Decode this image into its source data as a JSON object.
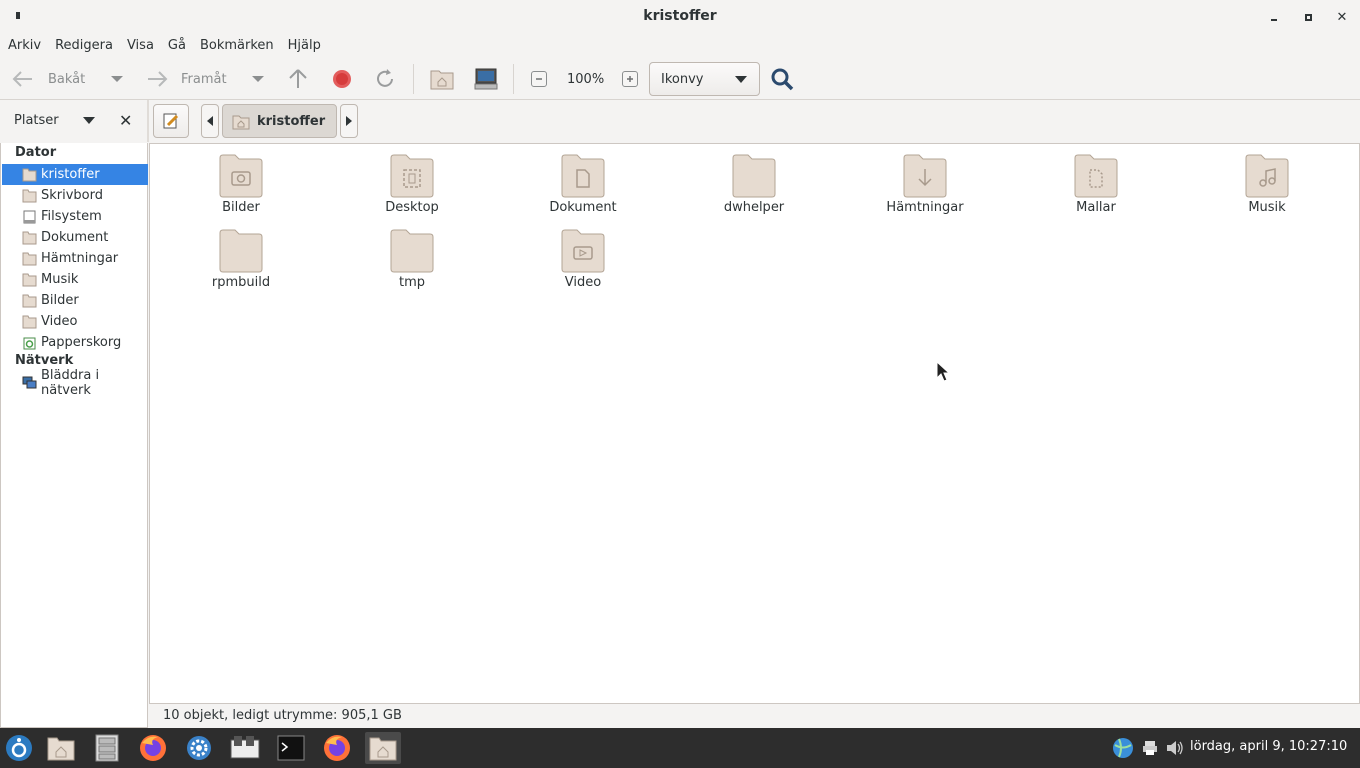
{
  "window": {
    "title": "kristoffer"
  },
  "menubar": [
    "Arkiv",
    "Redigera",
    "Visa",
    "Gå",
    "Bokmärken",
    "Hjälp"
  ],
  "toolbar": {
    "back_label": "Bakåt",
    "forward_label": "Framåt",
    "zoom_level": "100%",
    "view_mode": "Ikonvy"
  },
  "locationbar": {
    "places_label": "Platser",
    "crumb": "kristoffer"
  },
  "sidebar": {
    "sections": [
      {
        "title": "Dator",
        "items": [
          "kristoffer",
          "Skrivbord",
          "Filsystem",
          "Dokument",
          "Hämtningar",
          "Musik",
          "Bilder",
          "Video",
          "Papperskorg"
        ]
      },
      {
        "title": "Nätverk",
        "items": [
          "Bläddra i nätverk"
        ]
      }
    ],
    "selected": "kristoffer"
  },
  "files": [
    {
      "name": "Bilder",
      "icon": "pictures-folder-icon"
    },
    {
      "name": "Desktop",
      "icon": "desktop-folder-icon"
    },
    {
      "name": "Dokument",
      "icon": "documents-folder-icon"
    },
    {
      "name": "dwhelper",
      "icon": "folder-icon"
    },
    {
      "name": "Hämtningar",
      "icon": "downloads-folder-icon"
    },
    {
      "name": "Mallar",
      "icon": "templates-folder-icon"
    },
    {
      "name": "Musik",
      "icon": "music-folder-icon"
    },
    {
      "name": "rpmbuild",
      "icon": "folder-icon"
    },
    {
      "name": "tmp",
      "icon": "folder-icon"
    },
    {
      "name": "Video",
      "icon": "video-folder-icon"
    }
  ],
  "statusbar": {
    "text": "10 objekt, ledigt utrymme: 905,1 GB"
  },
  "taskbar": {
    "clock": "lördag, april  9, 10:27:10"
  },
  "colors": {
    "selection": "#3584e4",
    "folder": "#e6dbd0",
    "taskbar": "#2d2d2d"
  }
}
